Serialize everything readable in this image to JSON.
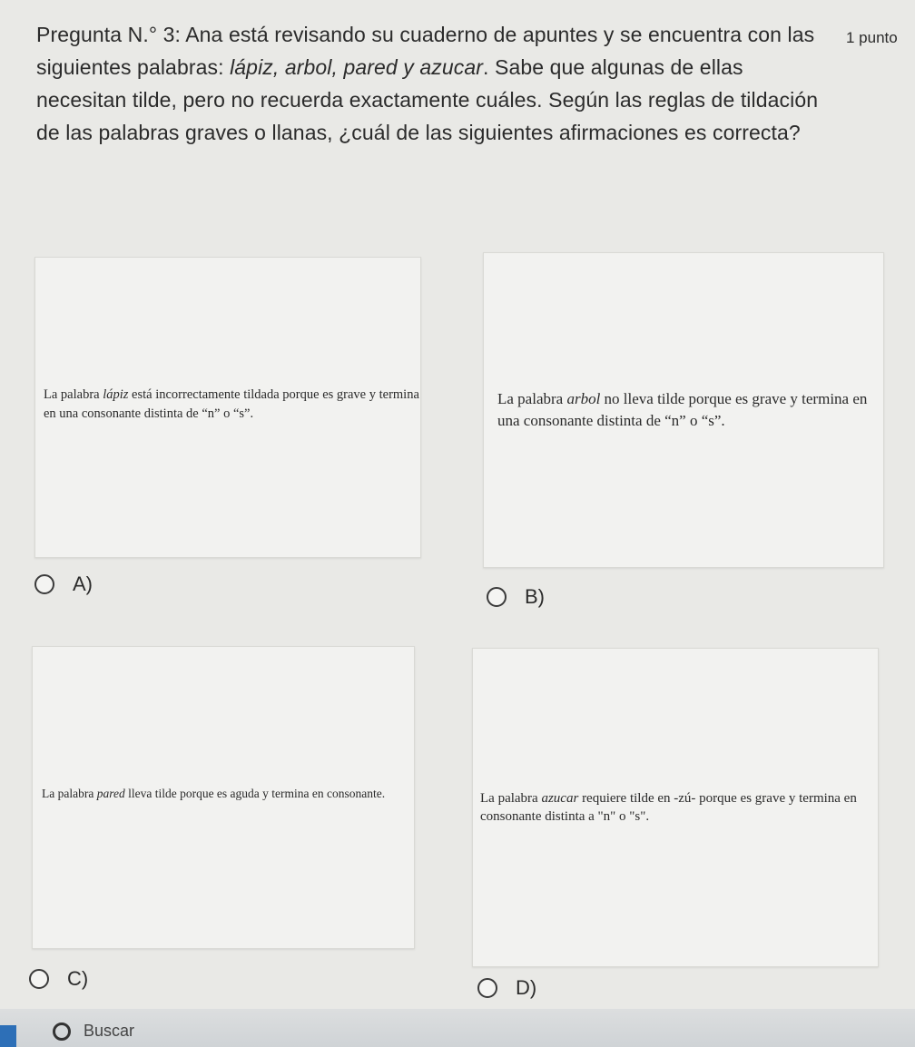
{
  "question": {
    "prefix": "Pregunta N.° 3: Ana está revisando su cuaderno de apuntes y se encuentra con las siguientes palabras: ",
    "words": "lápiz, arbol, pared y azucar",
    "suffix": ". Sabe que algunas de ellas necesitan tilde, pero no recuerda exactamente cuáles. Según las reglas de tildación de las palabras graves o llanas, ¿cuál de las siguientes afirmaciones es correcta?",
    "points": "1 punto"
  },
  "options": [
    {
      "letter": "A)",
      "text_pre": "La palabra ",
      "word": "lápiz",
      "text_post": " está incorrectamente tildada porque es grave y termina en una consonante distinta de “n” o “s”."
    },
    {
      "letter": "B)",
      "text_pre": "La palabra ",
      "word": "arbol",
      "text_post": " no lleva tilde porque es grave y termina en una consonante distinta de “n” o “s”."
    },
    {
      "letter": "C)",
      "text_pre": "La palabra ",
      "word": "pared",
      "text_post": " lleva tilde porque es aguda y termina en consonante."
    },
    {
      "letter": "D)",
      "text_pre": "La palabra ",
      "word": "azucar",
      "text_post": " requiere tilde en -zú- porque es grave y termina en consonante distinta a \"n\" o \"s\"."
    }
  ],
  "taskbar": {
    "search_label": "Buscar",
    "search_icon": "search-icon"
  },
  "cursor_icon": "pointer-cursor-icon"
}
